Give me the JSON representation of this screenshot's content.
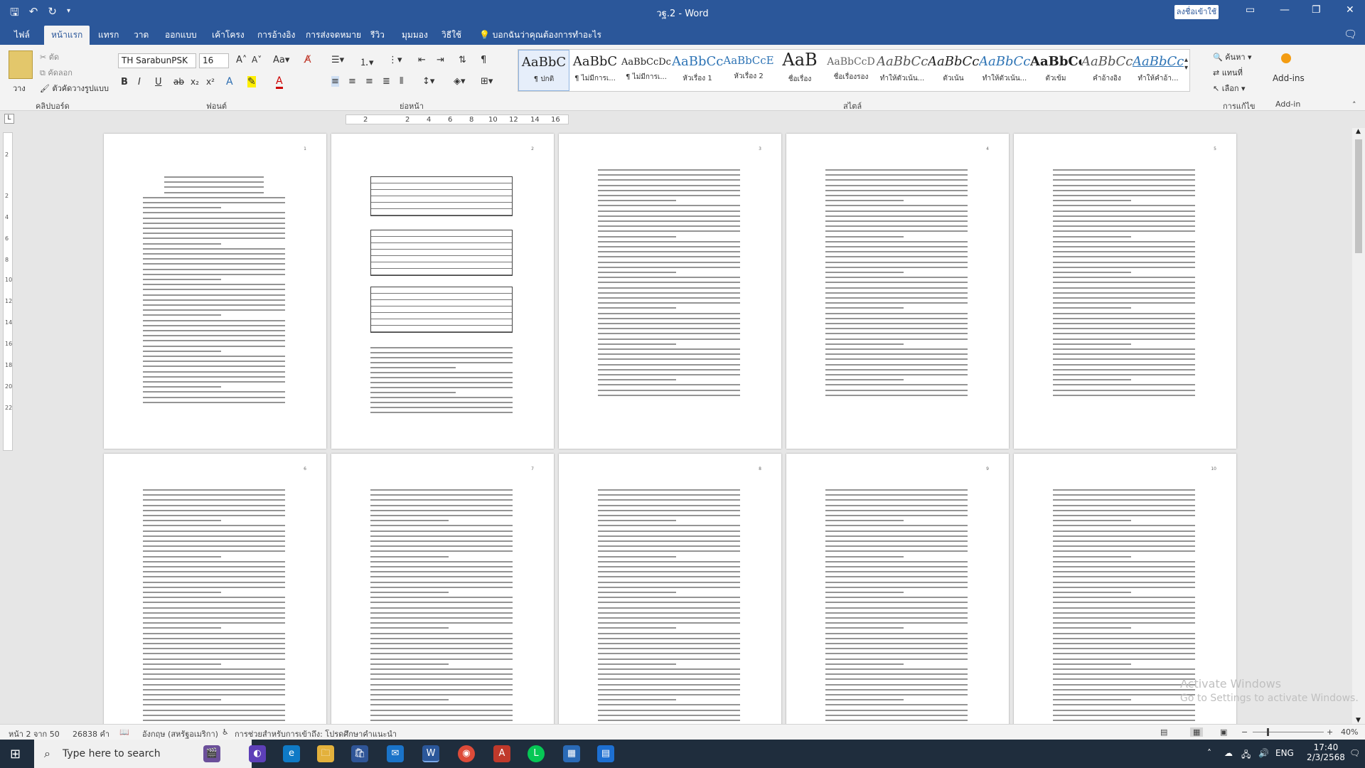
{
  "window": {
    "title": "วฐ.2 - Word",
    "signin": "ลงชื่อเข้าใช้",
    "minimize_icon": "minimize-icon",
    "restore_icon": "restore-icon",
    "close_icon": "close-icon"
  },
  "tabs": [
    "ไฟล์",
    "หน้าแรก",
    "แทรก",
    "วาด",
    "ออกแบบ",
    "เค้าโครง",
    "การอ้างอิง",
    "การส่งจดหมาย",
    "รีวิว",
    "มุมมอง",
    "วิธีใช้"
  ],
  "active_tab": "หน้าแรก",
  "tell_me": "บอกฉันว่าคุณต้องการทำอะไร",
  "ribbon": {
    "clipboard": {
      "label": "คลิปบอร์ด",
      "paste": "วาง",
      "cut": "ตัด",
      "copy": "คัดลอก",
      "format_painter": "ตัวคัดวางรูปแบบ"
    },
    "font": {
      "label": "ฟอนต์",
      "family": "TH SarabunPSK",
      "size": "16"
    },
    "paragraph": {
      "label": "ย่อหน้า"
    },
    "styles": {
      "label": "สไตล์",
      "items": [
        {
          "preview": "AaBbC",
          "name": "¶ ปกติ"
        },
        {
          "preview": "AaBbC",
          "name": "¶ ไม่มีการเ..."
        },
        {
          "preview": "AaBbCcDc",
          "name": "¶ ไม่มีการเ..."
        },
        {
          "preview": "AaBbCc",
          "name": "หัวเรื่อง 1"
        },
        {
          "preview": "AaBbCcE",
          "name": "หัวเรื่อง 2"
        },
        {
          "preview": "AaB",
          "name": "ชื่อเรื่อง"
        },
        {
          "preview": "AaBbCcD",
          "name": "ชื่อเรื่องรอง"
        },
        {
          "preview": "AaBbCc",
          "name": "ทำให้ตัวเน้น..."
        },
        {
          "preview": "AaBbCc",
          "name": "ตัวเน้น"
        },
        {
          "preview": "AaBbCc",
          "name": "ทำให้ตัวเน้น..."
        },
        {
          "preview": "AaBbCc",
          "name": "ตัวเข้ม"
        },
        {
          "preview": "AaBbCc",
          "name": "คำอ้างอิง"
        },
        {
          "preview": "AaBbCc",
          "name": "ทำให้คำอ้า..."
        }
      ]
    },
    "editing": {
      "label": "การแก้ไข",
      "find": "ค้นหา",
      "replace": "แทนที่",
      "select": "เลือก"
    },
    "addins": {
      "label": "Add-in",
      "button": "Add-ins"
    }
  },
  "ruler": {
    "numbers": [
      "2",
      "2",
      "4",
      "6",
      "8",
      "10",
      "12",
      "14",
      "16"
    ]
  },
  "vruler": {
    "numbers": [
      "2",
      "2",
      "4",
      "6",
      "8",
      "10",
      "12",
      "14",
      "16",
      "18",
      "20",
      "22"
    ]
  },
  "pages": [
    "1",
    "2",
    "3",
    "4",
    "5",
    "6",
    "7",
    "8",
    "9",
    "10"
  ],
  "status": {
    "page": "หน้า 2 จาก 50",
    "words": "26838 คำ",
    "language": "อังกฤษ (สหรัฐอเมริกา)",
    "accessibility": "การช่วยสำหรับการเข้าถึง: โปรดศึกษาคำแนะนำ",
    "zoom": "40%"
  },
  "taskbar": {
    "search_placeholder": "Type here to search",
    "lang": "ENG",
    "time": "17:40",
    "date": "2/3/2568"
  },
  "watermark": {
    "line1": "Activate Windows",
    "line2": "Go to Settings to activate Windows."
  }
}
